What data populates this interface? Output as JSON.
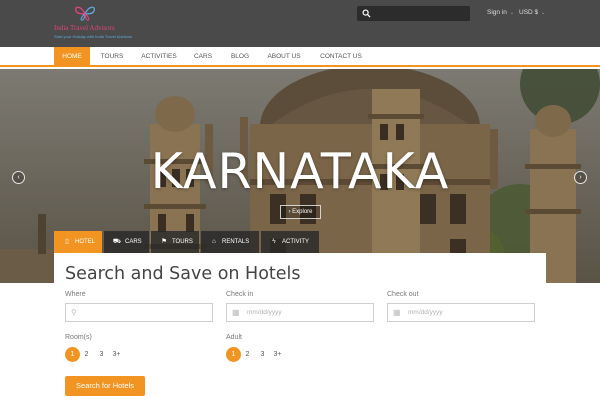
{
  "colors": {
    "accent": "#f29421",
    "topbar": "#4a4a4a",
    "brand_pink": "#e0447c",
    "brand_blue": "#5fa8d8"
  },
  "brand": {
    "title": "India Travel Advisors",
    "tagline": "Start your Holiday with India Travel Advisors"
  },
  "header": {
    "search": {
      "value": "",
      "placeholder": ""
    },
    "signin_label": "Sign in",
    "currency_label": "USD $"
  },
  "nav": {
    "items": [
      {
        "label": "HOME",
        "active": true
      },
      {
        "label": "TOURS"
      },
      {
        "label": "ACTIVITIES"
      },
      {
        "label": "CARS"
      },
      {
        "label": "BLOG"
      },
      {
        "label": "ABOUT US"
      },
      {
        "label": "CONTACT US"
      }
    ]
  },
  "hero": {
    "title": "KARNATAKA",
    "explore_label": "Explore",
    "prev_icon": "chevron-left-icon",
    "next_icon": "chevron-right-icon"
  },
  "tabs": [
    {
      "label": "HOTEL",
      "icon": "hotel-icon",
      "active": true
    },
    {
      "label": "CARS",
      "icon": "car-icon"
    },
    {
      "label": "TOURS",
      "icon": "flag-icon"
    },
    {
      "label": "RENTALS",
      "icon": "home-icon"
    },
    {
      "label": "ACTIVITY",
      "icon": "bolt-icon"
    }
  ],
  "form": {
    "title": "Search and Save on Hotels",
    "where": {
      "label": "Where",
      "value": "",
      "placeholder": ""
    },
    "checkin": {
      "label": "Check in",
      "placeholder": "mm/dd/yyyy"
    },
    "checkout": {
      "label": "Check out",
      "placeholder": "mm/dd/yyyy"
    },
    "rooms": {
      "label": "Room(s)",
      "options": [
        "1",
        "2",
        "3",
        "3+"
      ],
      "selected": "1"
    },
    "adults": {
      "label": "Adult",
      "options": [
        "1",
        "2",
        "3",
        "3+"
      ],
      "selected": "1"
    },
    "submit_label": "Search for Hotels"
  }
}
